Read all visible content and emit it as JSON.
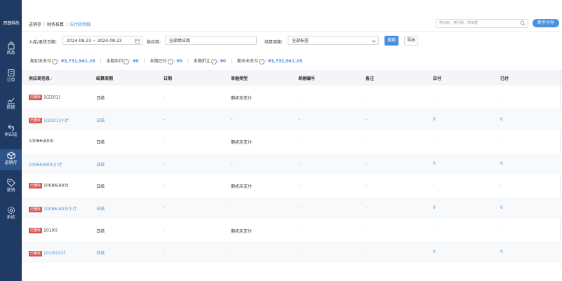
{
  "sidebar": {
    "logo_text": "西基科技",
    "items": [
      {
        "label": "商品",
        "icon": "bag-icon"
      },
      {
        "label": "订单",
        "icon": "order-icon"
      },
      {
        "label": "数据",
        "icon": "chart-icon"
      },
      {
        "label": "供应链",
        "icon": "exchange-icon"
      },
      {
        "label": "进销存",
        "icon": "cube-icon",
        "active": true
      },
      {
        "label": "营销",
        "icon": "tag-icon"
      },
      {
        "label": "系统",
        "icon": "settings-icon"
      }
    ]
  },
  "header": {
    "breadcrumb": [
      "进销存",
      "财务核算",
      "应付款明细"
    ],
    "search_placeholder": "搜功能、搜问题、搜单据",
    "guide_label": "新手引导"
  },
  "filters": {
    "date_label": "入库/退货日期:",
    "date_value": "2024-08-23 ~ 2024-08-23",
    "supplier_label": "供应商:",
    "supplier_value": "全部供应商",
    "settle_label": "结算周期:",
    "settle_value": "全部标签",
    "search_button": "搜索",
    "export_button": "导出"
  },
  "summary": {
    "opening_label": "期初未支付",
    "opening_value": "¥3,731,941.28",
    "payable_label": "本期应付",
    "payable_value": "¥0",
    "paid_label": "本期已付",
    "paid_value": "¥0",
    "discount_label": "本期折让",
    "discount_value": "¥0",
    "closing_label": "期末未支付",
    "closing_value": "¥3,731,941.28"
  },
  "table": {
    "columns": [
      "供应商信息",
      "结算周期",
      "日期",
      "单据类型",
      "单据编号",
      "备注",
      "应付",
      "已付"
    ],
    "sort_glyph": "⇕",
    "deleted_badge": "已删除",
    "rows": [
      {
        "supplier": "1(2101)",
        "deleted": true,
        "subtotal": false,
        "cycle": "日结",
        "date": "-",
        "type": "期初未支付",
        "no": "-",
        "note": "-",
        "payable": "-",
        "paid": "-"
      },
      {
        "supplier": "1(2101)小计",
        "deleted": true,
        "subtotal": true,
        "cycle": "日结",
        "date": "-",
        "type": "-",
        "no": "-",
        "note": "-",
        "payable": "0",
        "paid": "0"
      },
      {
        "supplier": "10066(A00)",
        "deleted": false,
        "subtotal": false,
        "cycle": "日结",
        "date": "-",
        "type": "期初未支付",
        "no": "-",
        "note": "-",
        "payable": "-",
        "paid": "-"
      },
      {
        "supplier": "10066(A00)小计",
        "deleted": false,
        "subtotal": true,
        "cycle": "日结",
        "date": "-",
        "type": "-",
        "no": "-",
        "note": "-",
        "payable": "0",
        "paid": "0"
      },
      {
        "supplier": "10086(A03)",
        "deleted": true,
        "subtotal": false,
        "cycle": "日结",
        "date": "-",
        "type": "期初未支付",
        "no": "-",
        "note": "-",
        "payable": "-",
        "paid": "-"
      },
      {
        "supplier": "10086(A03)小计",
        "deleted": true,
        "subtotal": true,
        "cycle": "日结",
        "date": "-",
        "type": "-",
        "no": "-",
        "note": "-",
        "payable": "0",
        "paid": "0"
      },
      {
        "supplier": "101(0)",
        "deleted": true,
        "subtotal": false,
        "cycle": "日结",
        "date": "-",
        "type": "期初未支付",
        "no": "-",
        "note": "-",
        "payable": "-",
        "paid": "-"
      },
      {
        "supplier": "101(0)小计",
        "deleted": true,
        "subtotal": true,
        "cycle": "日结",
        "date": "-",
        "type": "-",
        "no": "-",
        "note": "-",
        "payable": "0",
        "paid": "0"
      }
    ]
  },
  "colors": {
    "sidebar": "#1f3a63",
    "accent": "#4a90e2",
    "danger": "#d9534f"
  }
}
